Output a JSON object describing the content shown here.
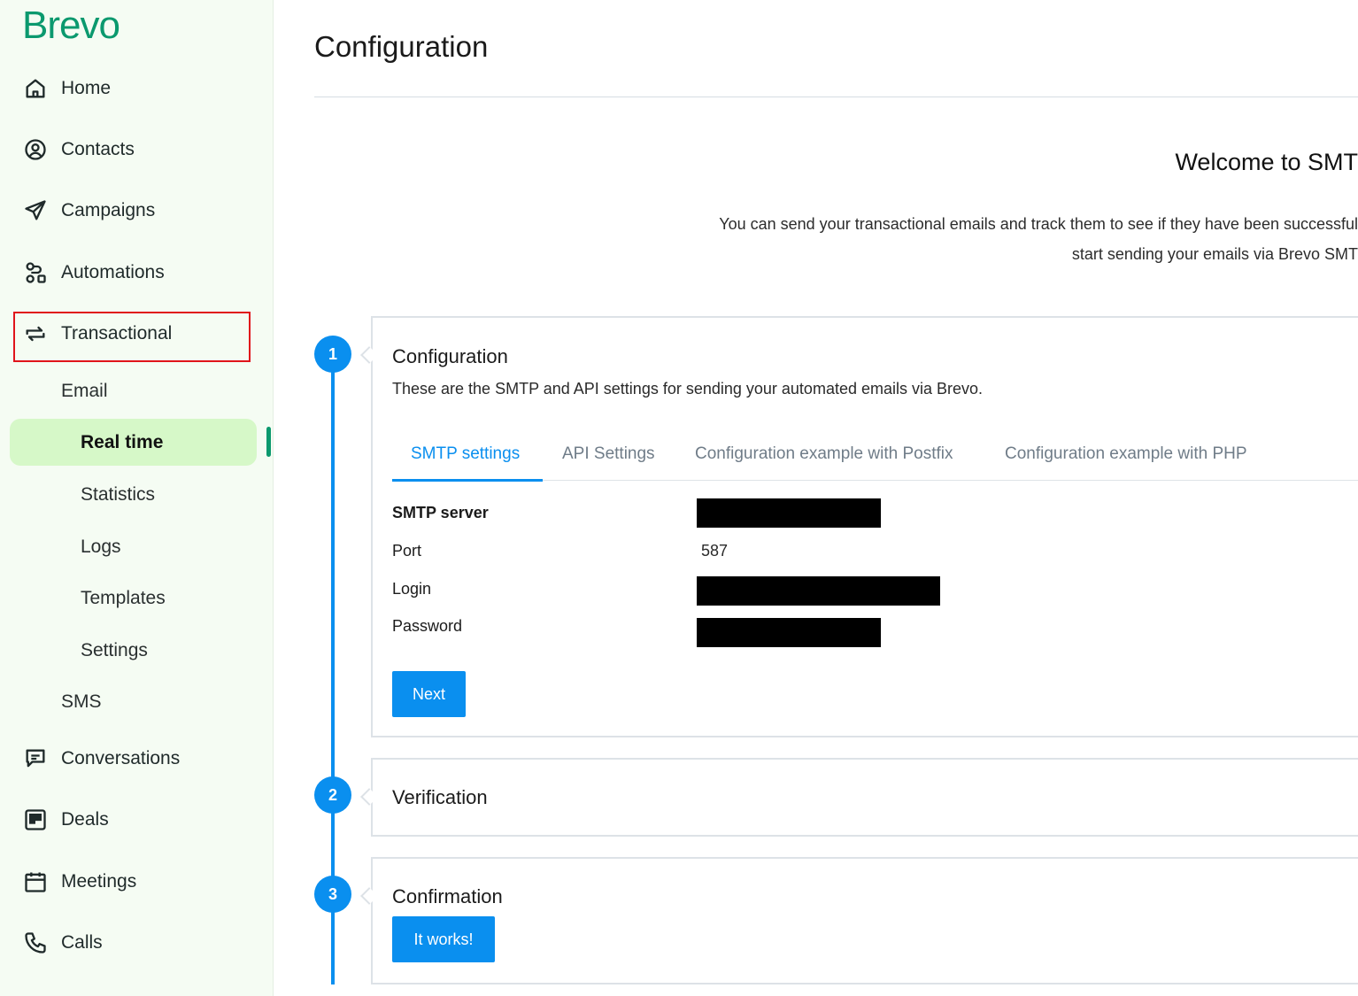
{
  "brand": "Brevo",
  "colors": {
    "brand_green": "#0b996e",
    "accent_blue": "#0a8fef",
    "active_bg": "#d6f8c8",
    "highlight_red": "#e0141b"
  },
  "sidebar": {
    "items": [
      {
        "label": "Home",
        "icon": "home-icon"
      },
      {
        "label": "Contacts",
        "icon": "contacts-icon"
      },
      {
        "label": "Campaigns",
        "icon": "paper-plane-icon"
      },
      {
        "label": "Automations",
        "icon": "automation-icon"
      },
      {
        "label": "Transactional",
        "icon": "swap-arrows-icon"
      },
      {
        "label": "Conversations",
        "icon": "chat-icon"
      },
      {
        "label": "Deals",
        "icon": "board-icon"
      },
      {
        "label": "Meetings",
        "icon": "calendar-icon"
      },
      {
        "label": "Calls",
        "icon": "phone-icon"
      }
    ],
    "transactional_sub": {
      "email": "Email",
      "email_items": [
        "Real time",
        "Statistics",
        "Logs",
        "Templates",
        "Settings"
      ],
      "sms": "SMS"
    }
  },
  "main": {
    "title": "Configuration",
    "welcome_title": "Welcome to SMT",
    "intro_line1": "You can send your transactional emails and track them to see if they have been successful",
    "intro_line2": "start sending your emails via Brevo SMT",
    "steps": [
      {
        "number": "1",
        "title": "Configuration",
        "description": "These are the SMTP and API settings for sending your automated emails via Brevo.",
        "tabs": [
          "SMTP settings",
          "API Settings",
          "Configuration example with Postfix",
          "Configuration example with PHP"
        ],
        "fields": [
          {
            "label": "SMTP server",
            "value": ""
          },
          {
            "label": "Port",
            "value": "587"
          },
          {
            "label": "Login",
            "value": ""
          },
          {
            "label": "Password",
            "value": ""
          }
        ],
        "button": "Next"
      },
      {
        "number": "2",
        "title": "Verification"
      },
      {
        "number": "3",
        "title": "Confirmation",
        "button": "It works!"
      }
    ]
  }
}
